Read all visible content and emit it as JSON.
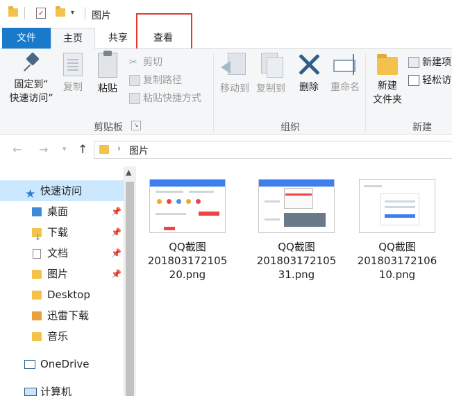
{
  "window": {
    "title": "图片"
  },
  "ribbon_tabs": [
    "文件",
    "主页",
    "共享",
    "查看"
  ],
  "clipboard": {
    "pin_label_1": "固定到“",
    "pin_label_2": "快速访问”",
    "copy": "复制",
    "paste": "粘贴",
    "cut": "剪切",
    "copy_path": "复制路径",
    "paste_shortcut": "粘贴快捷方式",
    "group": "剪贴板"
  },
  "organize": {
    "move_to": "移动到",
    "copy_to": "复制到",
    "delete": "删除",
    "rename": "重命名",
    "group": "组织"
  },
  "new": {
    "new_folder_1": "新建",
    "new_folder_2": "文件夹",
    "new_item": "新建项",
    "easy_access": "轻松访",
    "group": "新建"
  },
  "address": {
    "path": "图片"
  },
  "nav": [
    {
      "label": "快速访问",
      "selected": true
    },
    {
      "label": "桌面",
      "pinned": true
    },
    {
      "label": "下载",
      "pinned": true
    },
    {
      "label": "文档",
      "pinned": true
    },
    {
      "label": "图片",
      "pinned": true
    },
    {
      "label": "Desktop"
    },
    {
      "label": "迅雷下载"
    },
    {
      "label": "音乐"
    },
    {
      "label": "OneDrive"
    },
    {
      "label": "计算机"
    }
  ],
  "files": [
    {
      "line1": "QQ截图",
      "line2": "201803172105",
      "line3": "20.png"
    },
    {
      "line1": "QQ截图",
      "line2": "201803172105",
      "line3": "31.png"
    },
    {
      "line1": "QQ截图",
      "line2": "201803172106",
      "line3": "10.png"
    }
  ],
  "colors": {
    "accent": "#1979ca",
    "highlight": "#e53935",
    "nav_selected": "#cce8ff"
  }
}
